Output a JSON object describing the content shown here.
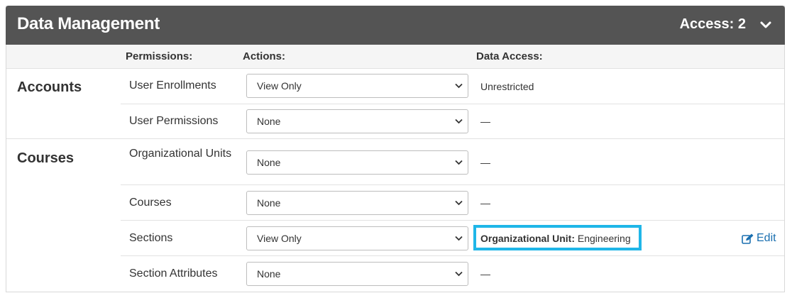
{
  "header": {
    "title": "Data Management",
    "access": "Access: 2",
    "toggle_icon": "chevron-down-icon"
  },
  "columns": {
    "permissions": "Permissions:",
    "actions": "Actions:",
    "data_access": "Data Access:"
  },
  "groups": [
    {
      "name": "Accounts",
      "rows": [
        {
          "permission": "User Enrollments",
          "action": "View Only",
          "data_access": "Unrestricted"
        },
        {
          "permission": "User Permissions",
          "action": "None",
          "data_access": "—"
        }
      ]
    },
    {
      "name": "Courses",
      "rows": [
        {
          "permission": "Organizational Units",
          "action": "None",
          "data_access": "—"
        },
        {
          "permission": "Courses",
          "action": "None",
          "data_access": "—"
        },
        {
          "permission": "Sections",
          "action": "View Only",
          "data_access_label": "Organizational Unit:",
          "data_access_value": "Engineering",
          "edit": "Edit",
          "edit_icon": "edit-icon"
        },
        {
          "permission": "Section Attributes",
          "action": "None",
          "data_access": "—"
        }
      ]
    }
  ],
  "colors": {
    "header_bg": "#545454",
    "highlight": "#1fb6e8",
    "link": "#1a6fb0"
  }
}
